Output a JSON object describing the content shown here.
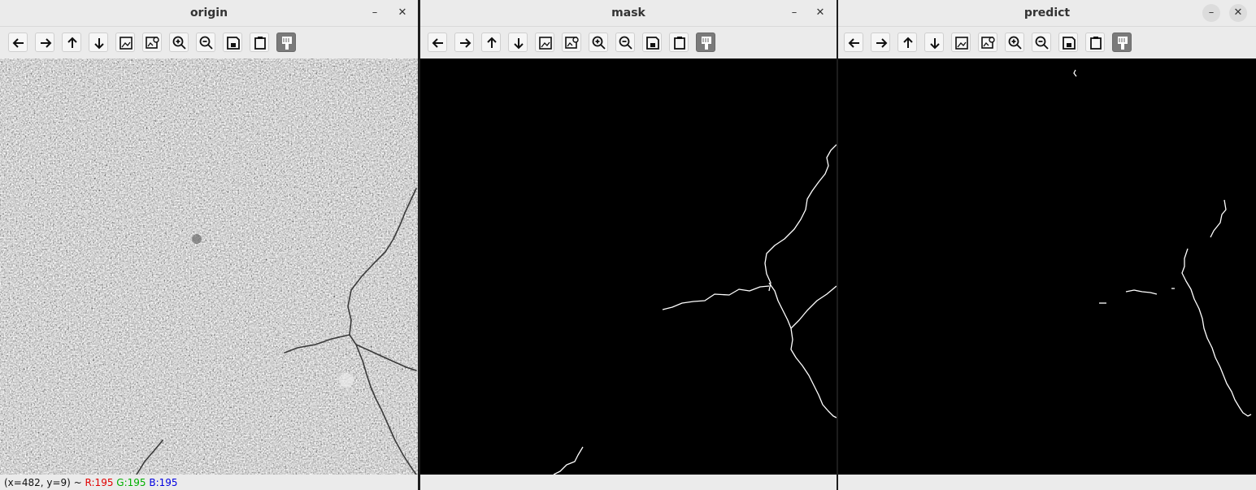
{
  "windows": [
    {
      "title": "origin",
      "status": {
        "coords": "(x=482, y=9) ~",
        "r": "R:195",
        "g": "G:195",
        "b": "B:195"
      }
    },
    {
      "title": "mask"
    },
    {
      "title": "predict"
    }
  ],
  "toolbar_icons": [
    "pan-left",
    "pan-right",
    "pan-up",
    "pan-down",
    "zoom-fit",
    "zoom-original",
    "zoom-in",
    "zoom-out",
    "save",
    "copy-clipboard",
    "properties"
  ],
  "controls": {
    "minimize": "–",
    "close": "✕"
  },
  "colors": {
    "window_bg": "#ebebeb",
    "image_bg": "#000000",
    "crack": "#ffffff",
    "status_r": "#e00000",
    "status_g": "#00b000",
    "status_b": "#0000e0"
  }
}
